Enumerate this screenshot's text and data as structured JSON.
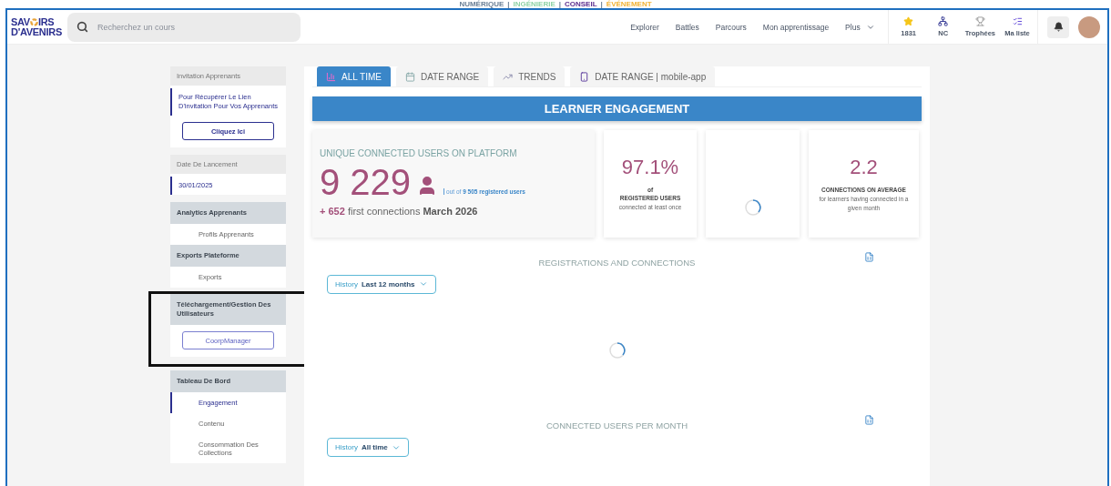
{
  "banner": {
    "separator": "|",
    "items": [
      {
        "text": "NUMÉRIQUE",
        "color": "#6a7f96"
      },
      {
        "text": "INGÉNIERIE",
        "color": "#8fd3a6"
      },
      {
        "text": "CONSEIL",
        "color": "#5b2d8e"
      },
      {
        "text": "ÉVÉNEMENT",
        "color": "#f2b233"
      }
    ]
  },
  "header": {
    "logo": {
      "left": "SAV",
      "right": "IRS",
      "line2": "D'AVENIRS"
    },
    "search": {
      "placeholder": "Recherchez un cours"
    },
    "nav": [
      {
        "label": "Explorer",
        "kind": "link"
      },
      {
        "label": "Battles",
        "kind": "link"
      },
      {
        "label": "Parcours",
        "kind": "link"
      },
      {
        "label": "Mon apprentissage",
        "kind": "link"
      },
      {
        "label": "Plus",
        "kind": "menu"
      }
    ],
    "stats": [
      {
        "label": "1831",
        "kind": "star"
      },
      {
        "label": "NC",
        "kind": "rank"
      },
      {
        "label": "Trophées",
        "kind": "trophy"
      },
      {
        "label": "Ma liste",
        "kind": "list"
      }
    ]
  },
  "sidebar": {
    "cards": [
      {
        "kind": "info",
        "title": "Invitation Apprenants",
        "text": "Pour Récupérer Le Lien D'invitation Pour Vos Apprenants",
        "button": "Cliquez Ici"
      },
      {
        "kind": "info",
        "title": "Date De Lancement",
        "value": "30/01/2025"
      },
      {
        "kind": "menu",
        "highlighted": false,
        "groups": [
          {
            "title": "Analytics Apprenants",
            "items": [
              {
                "label": "Profils Apprenants",
                "selected": false
              }
            ]
          },
          {
            "title": "Exports Plateforme",
            "items": [
              {
                "label": "Exports",
                "selected": false
              }
            ]
          }
        ]
      },
      {
        "kind": "menu",
        "highlighted": true,
        "groups": [
          {
            "title": "Téléchargement/Gestion Des Utilisateurs",
            "button": "CoorpManager"
          }
        ]
      },
      {
        "kind": "menu",
        "highlighted": false,
        "groups": [
          {
            "title": "Tableau De Bord",
            "items": [
              {
                "label": "Engagement",
                "selected": true
              },
              {
                "label": "Contenu",
                "selected": false
              },
              {
                "label": "Consommation Des Collections",
                "selected": false
              }
            ]
          }
        ]
      }
    ]
  },
  "main": {
    "tabs": [
      {
        "label": "ALL TIME",
        "kind": "bars",
        "selected": true
      },
      {
        "label": "DATE RANGE",
        "kind": "calendar",
        "selected": false
      },
      {
        "label": "TRENDS",
        "kind": "trend",
        "selected": false
      },
      {
        "label": "DATE RANGE | mobile-app",
        "kind": "phone",
        "selected": false
      }
    ],
    "title": "LEARNER ENGAGEMENT",
    "headline": {
      "title": "UNIQUE CONNECTED USERS ON PLATFORM",
      "value": "9 229",
      "note": "out of",
      "note_link": "9 505 registered users",
      "delta": "+ 652",
      "delta_text": "first connections",
      "period": "March 2026"
    },
    "kpis": [
      {
        "kind": "stat",
        "value": "97.1%",
        "label": "of",
        "caption": "REGISTERED USERS",
        "sub": "connected at least once"
      },
      {
        "kind": "loading"
      },
      {
        "kind": "stat",
        "value": "2.2",
        "caption": "CONNECTIONS ON AVERAGE",
        "sub": "for learners having connected in a given month"
      }
    ],
    "sections": [
      {
        "title": "REGISTRATIONS AND CONNECTIONS",
        "filter_label": "History",
        "filter_value": "Last 12 months",
        "loading": true
      },
      {
        "title": "CONNECTED USERS PER MONTH",
        "filter_label": "History",
        "filter_value": "All time",
        "loading": false
      }
    ]
  }
}
